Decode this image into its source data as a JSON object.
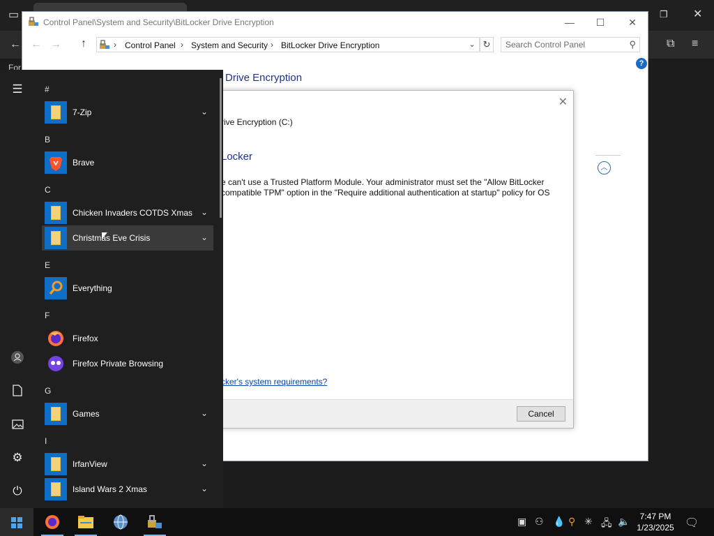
{
  "control_panel": {
    "title": "Control Panel\\System and Security\\BitLocker Drive Encryption",
    "breadcrumb": [
      "Control Panel",
      "System and Security",
      "BitLocker Drive Encryption"
    ],
    "search_placeholder": "Search Control Panel",
    "heading_partial": "Drive Encryption",
    "window_buttons": {
      "minimize": "—",
      "maximize": "☐",
      "close": "✕"
    }
  },
  "dialog": {
    "drive_label": "rive Encryption (C:)",
    "heading": "Locker",
    "message_line1": "e can't use a Trusted Platform Module. Your administrator must set the \"Allow BitLocker",
    "message_line2": "compatible TPM\" option in the \"Require additional authentication at startup\" policy for OS",
    "link": "cker's system requirements?",
    "cancel_label": "Cancel"
  },
  "start_menu": {
    "letters": [
      "#",
      "B",
      "C",
      "E",
      "F",
      "G",
      "I"
    ],
    "apps": [
      {
        "label": "7-Zip",
        "icon": "folder-icon",
        "expandable": true
      },
      {
        "label": "Brave",
        "icon": "brave-icon",
        "expandable": false
      },
      {
        "label": "Chicken Invaders COTDS Xmas",
        "icon": "folder-icon",
        "expandable": true
      },
      {
        "label": "Christmas Eve Crisis",
        "icon": "folder-icon",
        "expandable": true,
        "hover": true
      },
      {
        "label": "Everything",
        "icon": "everything-icon",
        "expandable": false
      },
      {
        "label": "Firefox",
        "icon": "firefox-icon",
        "expandable": false
      },
      {
        "label": "Firefox Private Browsing",
        "icon": "firefox-private-icon",
        "expandable": false
      },
      {
        "label": "Games",
        "icon": "folder-icon",
        "expandable": true
      },
      {
        "label": "IrfanView",
        "icon": "folder-icon",
        "expandable": true
      },
      {
        "label": "Island Wars 2 Xmas",
        "icon": "folder-icon",
        "expandable": true
      }
    ]
  },
  "taskbar": {
    "time": "7:47 PM",
    "date": "1/23/2025",
    "pinned": [
      "firefox-icon",
      "file-explorer-icon",
      "network-globe-icon",
      "control-panel-icon"
    ]
  },
  "browser": {
    "bookmark_fragment": "For"
  },
  "colors": {
    "accent": "#0f6fc6",
    "heading_blue": "#1e3287",
    "link_blue": "#0645ad",
    "start_bg": "#1f1f1f",
    "taskbar_bg": "#101010"
  }
}
